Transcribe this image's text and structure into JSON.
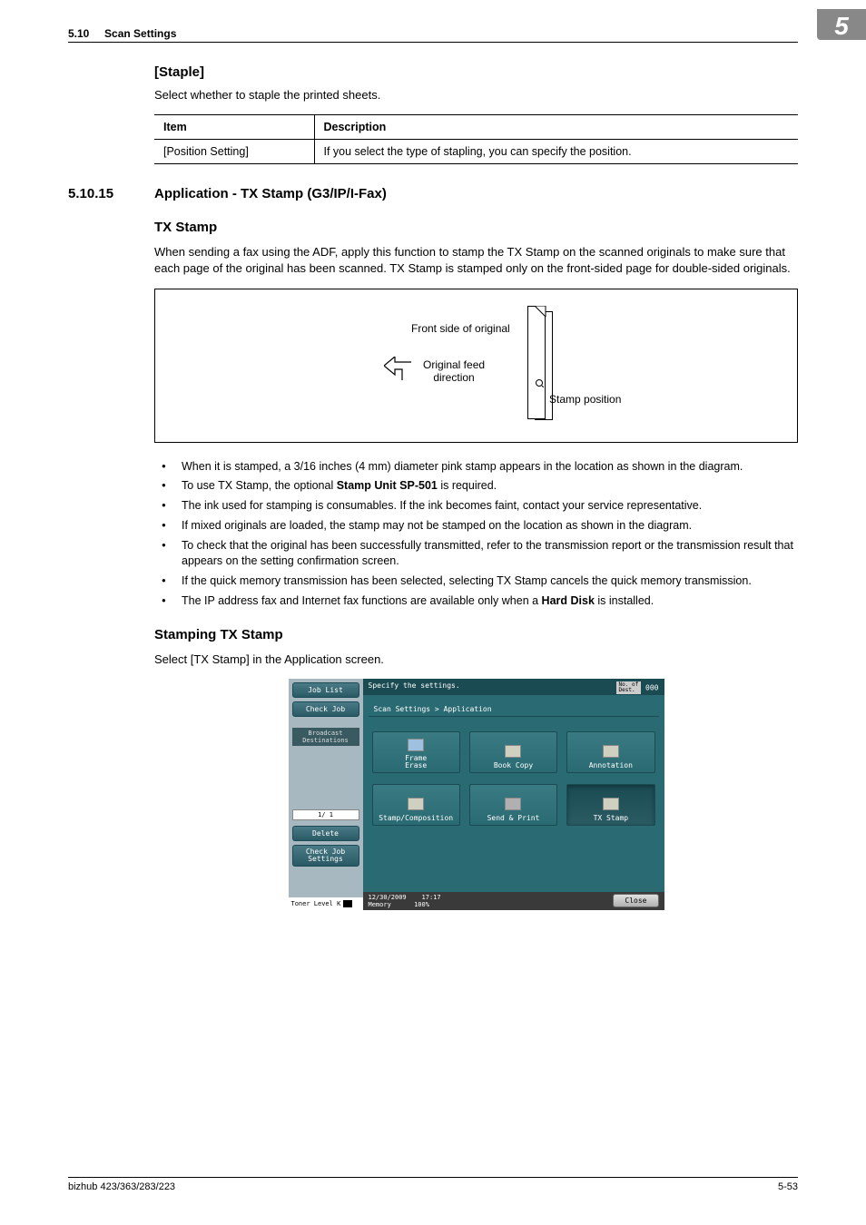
{
  "header": {
    "section_num": "5.10",
    "section_title": "Scan Settings",
    "chapter": "5"
  },
  "staple": {
    "heading": "[Staple]",
    "intro": "Select whether to staple the printed sheets.",
    "th_item": "Item",
    "th_desc": "Description",
    "row_item": "[Position Setting]",
    "row_desc": "If you select the type of stapling, you can specify the position."
  },
  "section": {
    "num": "5.10.15",
    "title": "Application - TX Stamp (G3/IP/I-Fax)"
  },
  "txstamp": {
    "heading": "TX Stamp",
    "para": "When sending a fax using the ADF, apply this function to stamp the TX Stamp on the scanned originals to make sure that each page of the original has been scanned. TX Stamp is stamped only on the front-sided page for double-sided originals.",
    "diagram": {
      "front_label": "Front side of original",
      "feed_label_1": "Original feed",
      "feed_label_2": "direction",
      "stamp_label": "Stamp position"
    },
    "bullets": {
      "b1_a": "When it is stamped, a 3/16 inches (4 mm) diameter pink stamp appears in the location as shown in the diagram.",
      "b2_a": "To use TX Stamp, the optional ",
      "b2_bold": "Stamp Unit SP-501",
      "b2_c": " is required.",
      "b3": "The ink used for stamping is consumables. If the ink becomes faint, contact your service representative.",
      "b4": "If mixed originals are loaded, the stamp may not be stamped on the location as shown in the diagram.",
      "b5": "To check that the original has been successfully transmitted, refer to the transmission report or the transmission result that appears on the setting confirmation screen.",
      "b6": "If the quick memory transmission has been selected, selecting TX Stamp cancels the quick memory transmission.",
      "b7_a": "The IP address fax and Internet fax functions are available only when a ",
      "b7_bold": "Hard Disk",
      "b7_c": " is installed."
    }
  },
  "stamping": {
    "heading": "Stamping TX Stamp",
    "para": "Select [TX Stamp] in the Application screen."
  },
  "screenshot": {
    "left": {
      "job_list": "Job List",
      "check_job": "Check Job",
      "broadcast": "Broadcast\nDestinations",
      "pager": "1/  1",
      "delete": "Delete",
      "check_settings": "Check Job\nSettings",
      "toner": "Toner Level",
      "toner_k": "K"
    },
    "top": {
      "specify": "Specify the settings.",
      "dest_label": "No. of\nDest.",
      "dest_count": "000"
    },
    "breadcrumb": "Scan Settings > Application",
    "tiles": {
      "t1": "Frame\nErase",
      "t2": "Book Copy",
      "t3": "Annotation",
      "t4": "Stamp/Composition",
      "t5": "Send & Print",
      "t6": "TX Stamp"
    },
    "bottom": {
      "date": "12/30/2009",
      "time": "17:17",
      "mem_label": "Memory",
      "mem_val": "100%",
      "close": "Close"
    }
  },
  "footer": {
    "left": "bizhub 423/363/283/223",
    "right": "5-53"
  }
}
